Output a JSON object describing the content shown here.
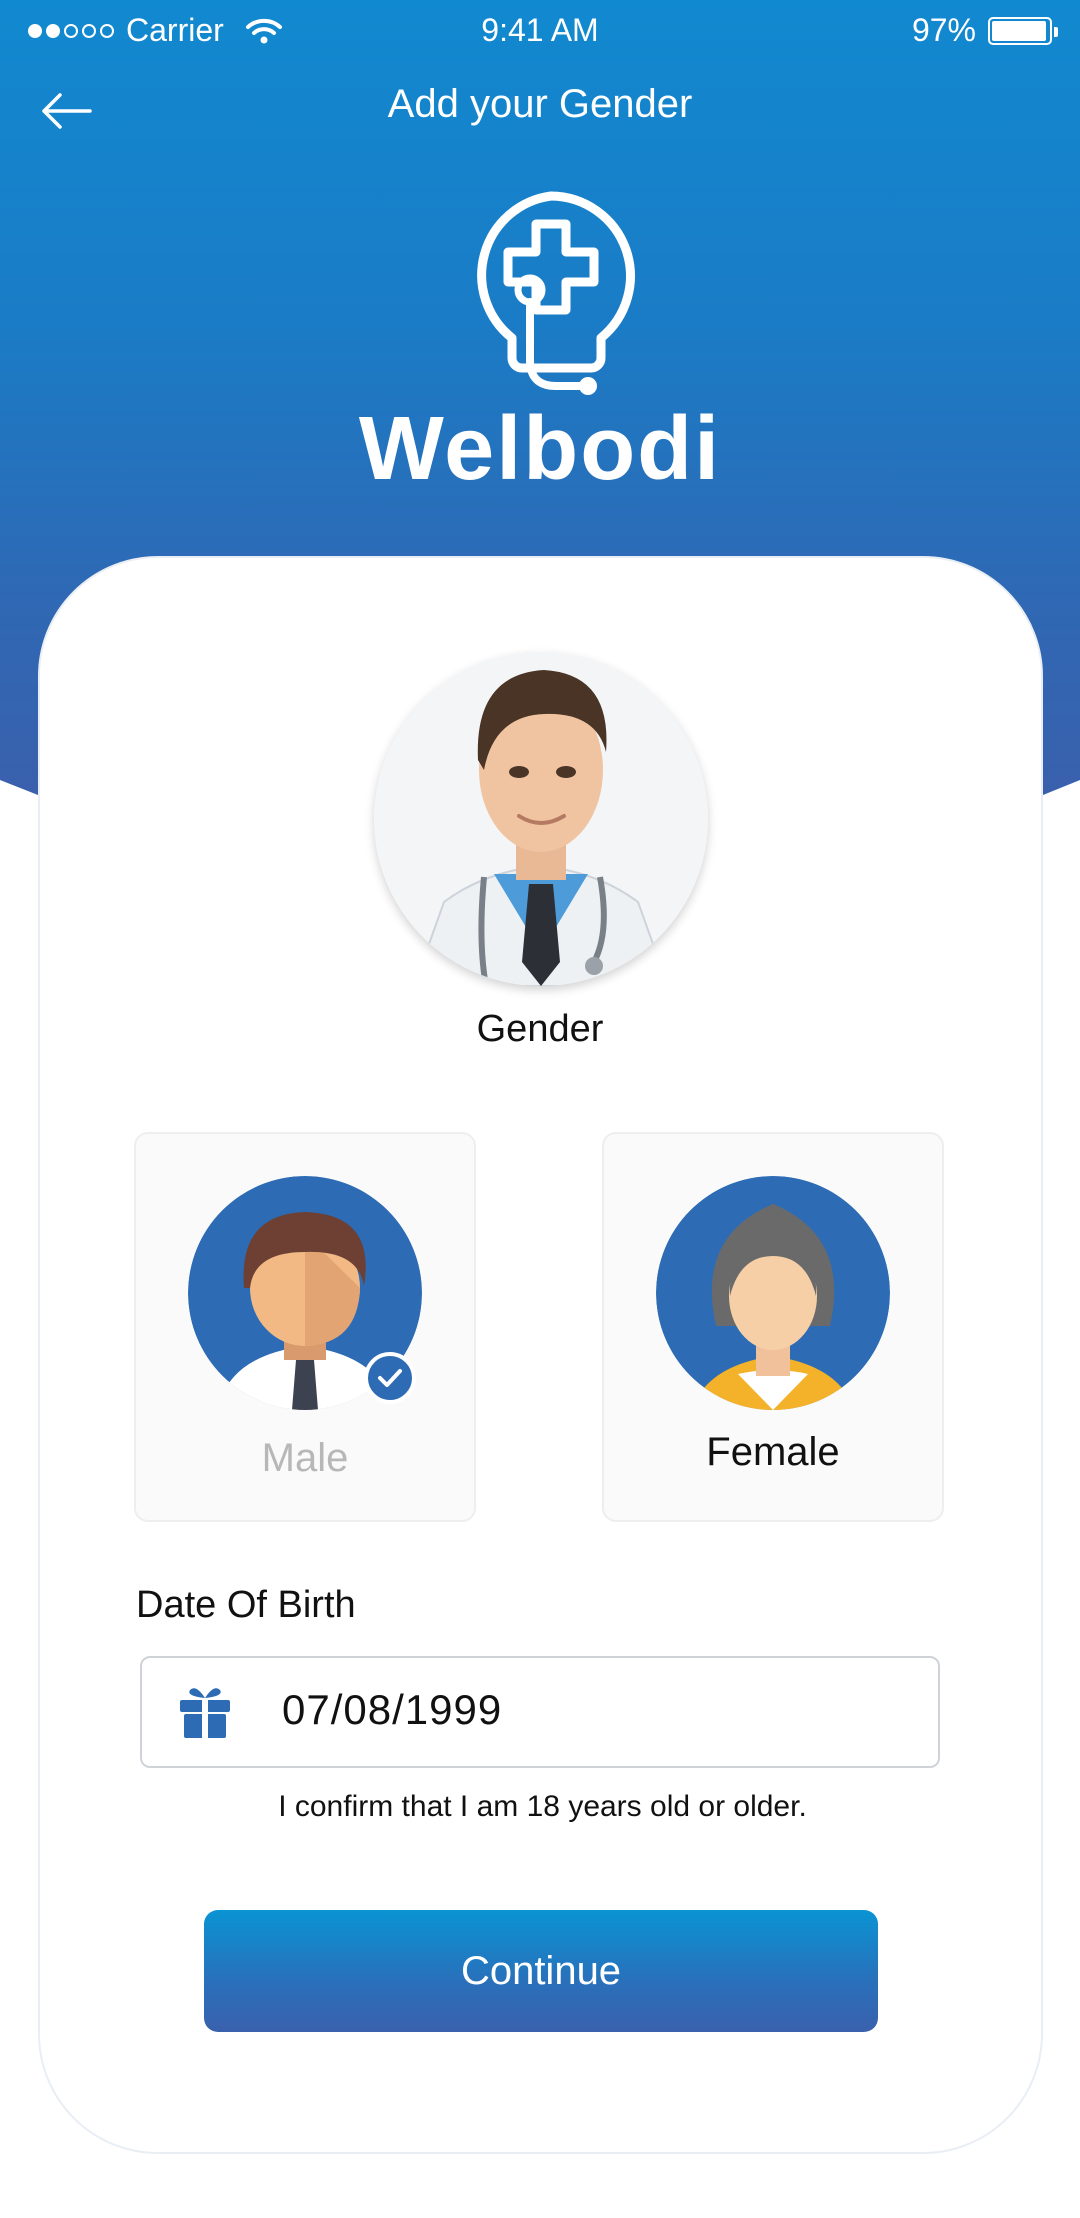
{
  "status_bar": {
    "carrier": "Carrier",
    "time": "9:41 AM",
    "battery": "97%"
  },
  "nav": {
    "title": "Add your Gender"
  },
  "brand": {
    "name": "Welbodi"
  },
  "gender": {
    "heading": "Gender",
    "options": [
      {
        "label": "Male",
        "selected": true
      },
      {
        "label": "Female",
        "selected": false
      }
    ]
  },
  "dob": {
    "label": "Date Of Birth",
    "value": "07/08/1999",
    "confirm_text": "I confirm that I am 18 years old or older."
  },
  "actions": {
    "continue_label": "Continue"
  },
  "colors": {
    "brand_blue": "#1a7cc6",
    "accent_dark": "#2d6cb5",
    "text": "#111111",
    "muted": "#b7b7b7"
  }
}
